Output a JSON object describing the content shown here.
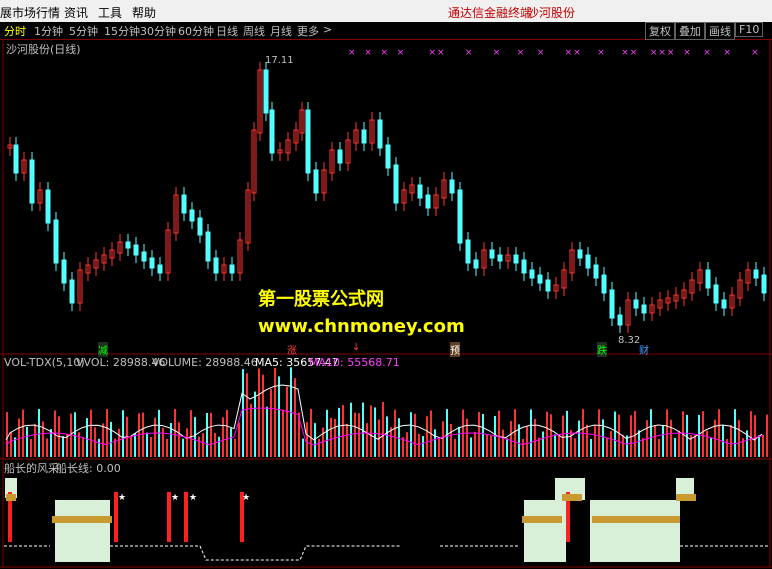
{
  "menu": {
    "app_title": "展市场行情",
    "items": [
      "资讯",
      "工具",
      "帮助"
    ],
    "right_items": [
      "通达信金融终端",
      "沙河股份"
    ]
  },
  "periods": {
    "items": [
      "分时",
      "1分钟",
      "5分钟",
      "15分钟",
      "30分钟",
      "60分钟",
      "日线",
      "周线",
      "月线",
      "更多"
    ],
    "active": "日线",
    "more_arrow": ">",
    "right_buttons": [
      "复权",
      "叠加",
      "画线",
      "F10"
    ]
  },
  "main_chart": {
    "title": "沙河股份(日线)",
    "high_label": "17.11",
    "low_label": "8.32",
    "markers": [
      "减",
      "涨",
      "↓",
      "预",
      "跌",
      "财"
    ],
    "x_marks_text": "×  ×  ×  ×      ××     ×     ×    ×   ×     ××    ×    ××   ×××  ×   ×   ×     ×"
  },
  "volume_panel": {
    "indicator": "VOL-TDX(5,10)",
    "vvol_label": "VVOL: 28988.46",
    "volume_label": "VOLUME: 28988.46",
    "ma5_label": "MA5: 35657.47",
    "ma10_label": "MA10: 55568.71"
  },
  "indicator_panel": {
    "name": "船长的风采",
    "line_label": "船长线: 0.00"
  },
  "watermark": {
    "line1": "第一股票公式网",
    "line2": "www.chnmoney.com"
  },
  "colors": {
    "up": "#ff3232",
    "down": "#54ffff",
    "ma5": "#ffffff",
    "ma10": "#ff00ff",
    "accent": "#ffff00",
    "grid": "#800000"
  }
}
